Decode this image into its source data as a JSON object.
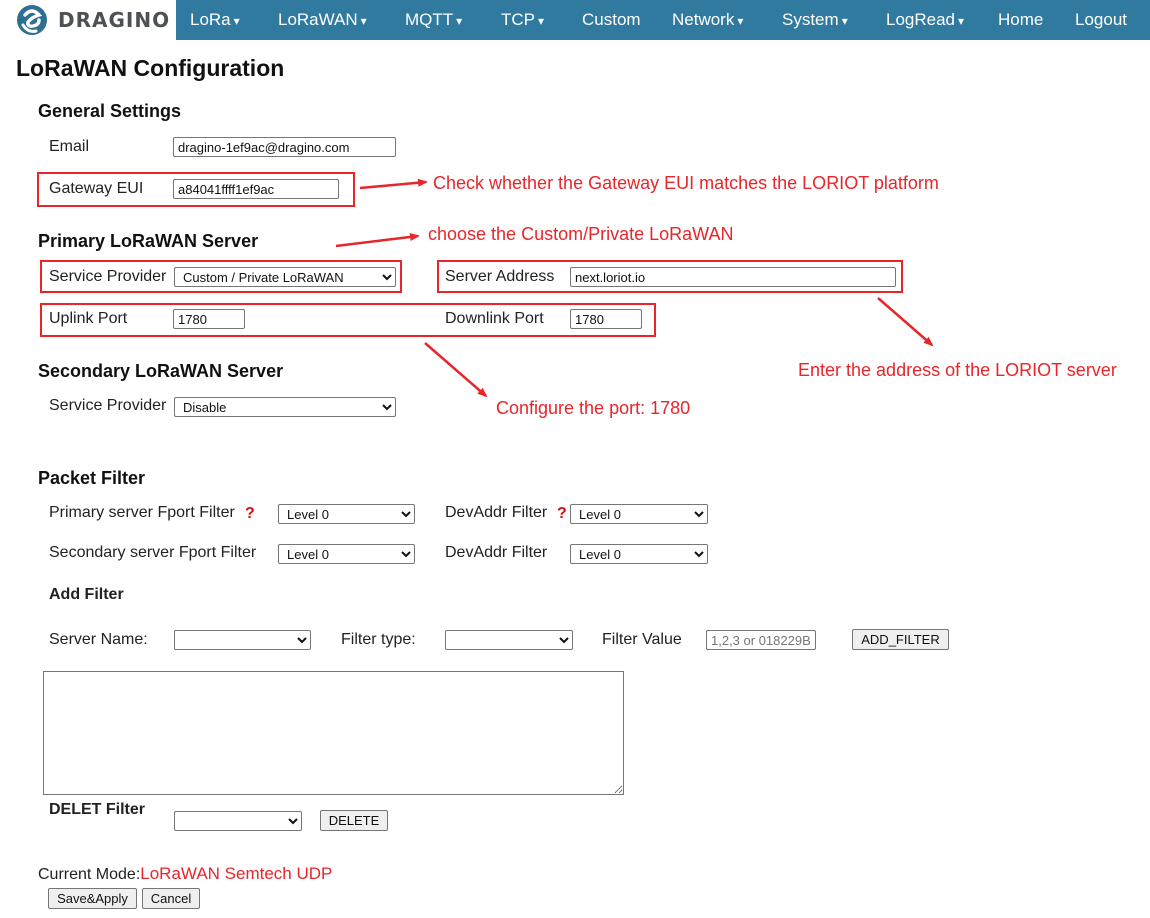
{
  "brand": {
    "logo_text": "DRAGINO"
  },
  "nav": {
    "items": [
      {
        "label": "LoRa",
        "caret": "▾"
      },
      {
        "label": "LoRaWAN",
        "caret": "▾"
      },
      {
        "label": "MQTT",
        "caret": "▾"
      },
      {
        "label": "TCP",
        "caret": "▾"
      },
      {
        "label": "Custom",
        "caret": ""
      },
      {
        "label": "Network",
        "caret": "▾"
      },
      {
        "label": "System",
        "caret": "▾"
      },
      {
        "label": "LogRead",
        "caret": "▾"
      },
      {
        "label": "Home",
        "caret": ""
      },
      {
        "label": "Logout",
        "caret": ""
      }
    ]
  },
  "page": {
    "title": "LoRaWAN Configuration"
  },
  "general": {
    "heading": "General Settings",
    "email_label": "Email",
    "email_value": "dragino-1ef9ac@dragino.com",
    "eui_label": "Gateway EUI",
    "eui_value": "a84041ffff1ef9ac"
  },
  "primary": {
    "heading": "Primary LoRaWAN Server",
    "provider_label": "Service Provider",
    "provider_value": "Custom / Private LoRaWAN",
    "address_label": "Server Address",
    "address_value": "next.loriot.io",
    "uplink_label": "Uplink Port",
    "uplink_value": "1780",
    "downlink_label": "Downlink Port",
    "downlink_value": "1780"
  },
  "secondary": {
    "heading": "Secondary LoRaWAN Server",
    "provider_label": "Service Provider",
    "provider_value": "Disable"
  },
  "filter": {
    "heading": "Packet Filter",
    "primary_fport_label": "Primary server Fport Filter",
    "primary_fport_value": "Level 0",
    "devaddr_label": "DevAddr Filter",
    "primary_devaddr_value": "Level 0",
    "secondary_fport_label": "Secondary server Fport Filter",
    "secondary_fport_value": "Level 0",
    "secondary_devaddr_value": "Level 0",
    "help_mark": "?",
    "add_heading": "Add Filter",
    "server_name_label": "Server Name:",
    "filter_type_label": "Filter type:",
    "filter_value_label": "Filter Value",
    "filter_value_placeholder": "1,2,3 or 018229B",
    "add_button": "ADD_FILTER",
    "delete_heading": "DELET Filter",
    "delete_button": "DELETE"
  },
  "footer": {
    "mode_label": "Current Mode:",
    "mode_value": "LoRaWAN Semtech UDP",
    "save_button": "Save&Apply",
    "cancel_button": "Cancel"
  },
  "annotations": {
    "eui_note": "Check whether the Gateway EUI matches the LORIOT platform",
    "provider_note": "choose the Custom/Private LoRaWAN",
    "address_note": "Enter the address of the LORIOT server",
    "port_note": "Configure the port: 1780",
    "color": "#e8252a"
  },
  "colors": {
    "nav_bg": "#2f7a9e",
    "mode_text": "#e8252a"
  }
}
